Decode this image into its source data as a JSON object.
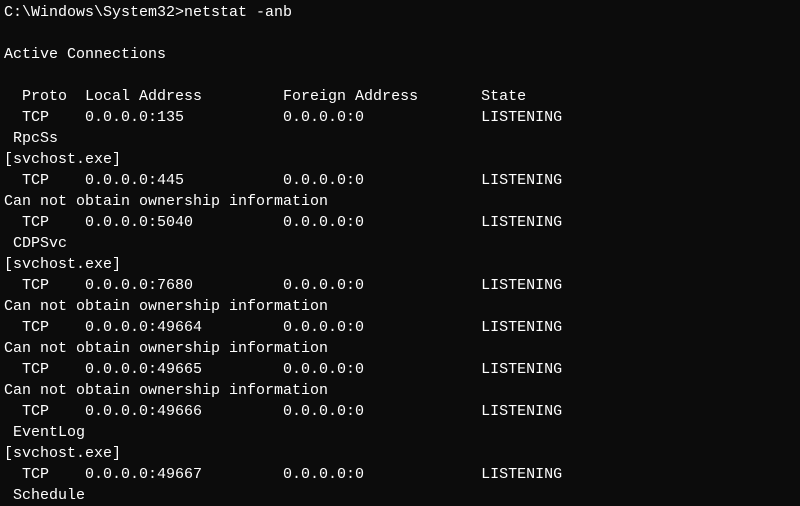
{
  "prompt": "C:\\Windows\\System32>",
  "command": "netstat -anb",
  "title": "Active Connections",
  "headers": {
    "proto": "Proto",
    "local": "Local Address",
    "foreign": "Foreign Address",
    "state": "State"
  },
  "entries": [
    {
      "proto": "TCP",
      "local": "0.0.0.0:135",
      "foreign": "0.0.0.0:0",
      "state": "LISTENING",
      "owner_lines": [
        " RpcSs",
        "[svchost.exe]"
      ]
    },
    {
      "proto": "TCP",
      "local": "0.0.0.0:445",
      "foreign": "0.0.0.0:0",
      "state": "LISTENING",
      "owner_lines": [
        "Can not obtain ownership information"
      ]
    },
    {
      "proto": "TCP",
      "local": "0.0.0.0:5040",
      "foreign": "0.0.0.0:0",
      "state": "LISTENING",
      "owner_lines": [
        " CDPSvc",
        "[svchost.exe]"
      ]
    },
    {
      "proto": "TCP",
      "local": "0.0.0.0:7680",
      "foreign": "0.0.0.0:0",
      "state": "LISTENING",
      "owner_lines": [
        "Can not obtain ownership information"
      ]
    },
    {
      "proto": "TCP",
      "local": "0.0.0.0:49664",
      "foreign": "0.0.0.0:0",
      "state": "LISTENING",
      "owner_lines": [
        "Can not obtain ownership information"
      ]
    },
    {
      "proto": "TCP",
      "local": "0.0.0.0:49665",
      "foreign": "0.0.0.0:0",
      "state": "LISTENING",
      "owner_lines": [
        "Can not obtain ownership information"
      ]
    },
    {
      "proto": "TCP",
      "local": "0.0.0.0:49666",
      "foreign": "0.0.0.0:0",
      "state": "LISTENING",
      "owner_lines": [
        " EventLog",
        "[svchost.exe]"
      ]
    },
    {
      "proto": "TCP",
      "local": "0.0.0.0:49667",
      "foreign": "0.0.0.0:0",
      "state": "LISTENING",
      "owner_lines": [
        " Schedule"
      ]
    }
  ]
}
